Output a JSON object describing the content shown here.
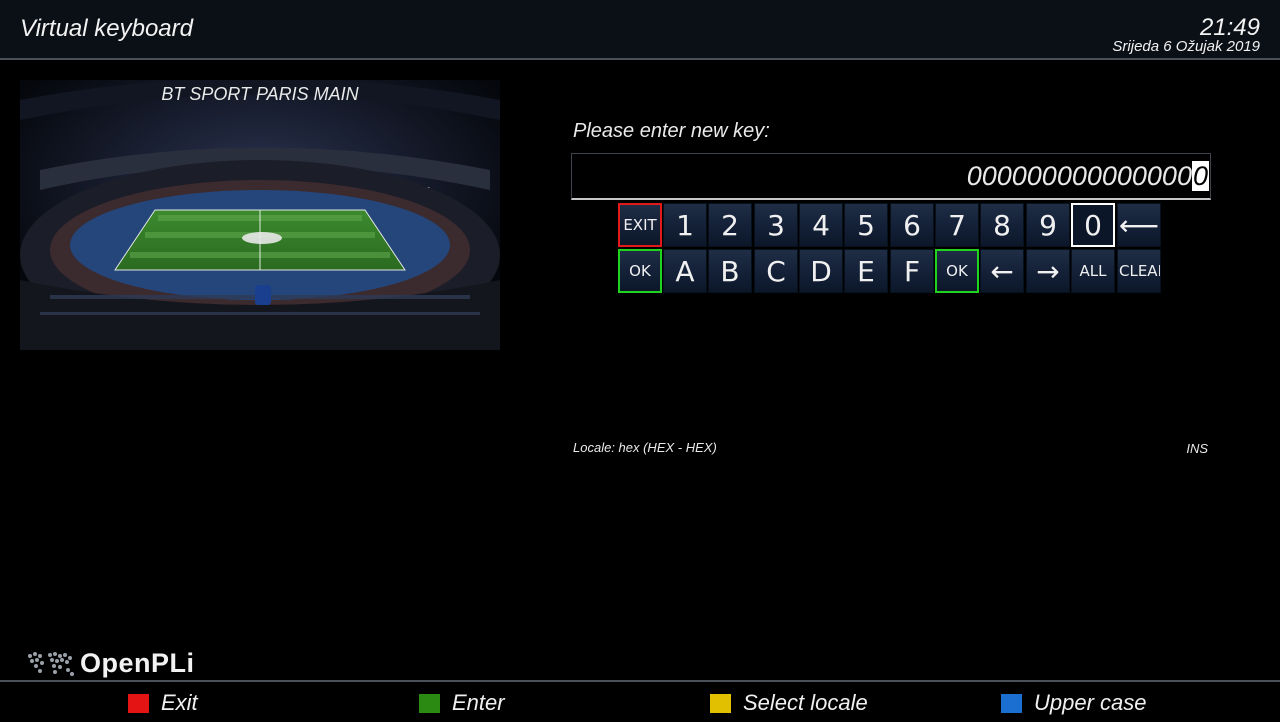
{
  "header": {
    "title": "Virtual keyboard",
    "time": "21:49",
    "date": "Srijeda  6 Ožujak 2019"
  },
  "preview": {
    "channel": "BT SPORT PARIS MAIN"
  },
  "prompt": "Please enter new key:",
  "input": {
    "value": "000000000000000",
    "cursor_char": "0"
  },
  "keyboard": {
    "row1": [
      "EXIT",
      "1",
      "2",
      "3",
      "4",
      "5",
      "6",
      "7",
      "8",
      "9",
      "0",
      "⟵"
    ],
    "row2": [
      "OK",
      "A",
      "B",
      "C",
      "D",
      "E",
      "F",
      "OK",
      "←",
      "→",
      "ALL",
      "CLEAR"
    ],
    "selected_key": "0"
  },
  "status": {
    "locale": "Locale: hex  (HEX - HEX)",
    "mode": "INS"
  },
  "logo": "OpenPLi",
  "footer": {
    "red": "Exit",
    "green": "Enter",
    "yellow": "Select locale",
    "blue": "Upper case"
  },
  "colors": {
    "red": "#e41414",
    "green": "#2a8a12",
    "yellow": "#e0c000",
    "blue": "#1a6fd0"
  }
}
